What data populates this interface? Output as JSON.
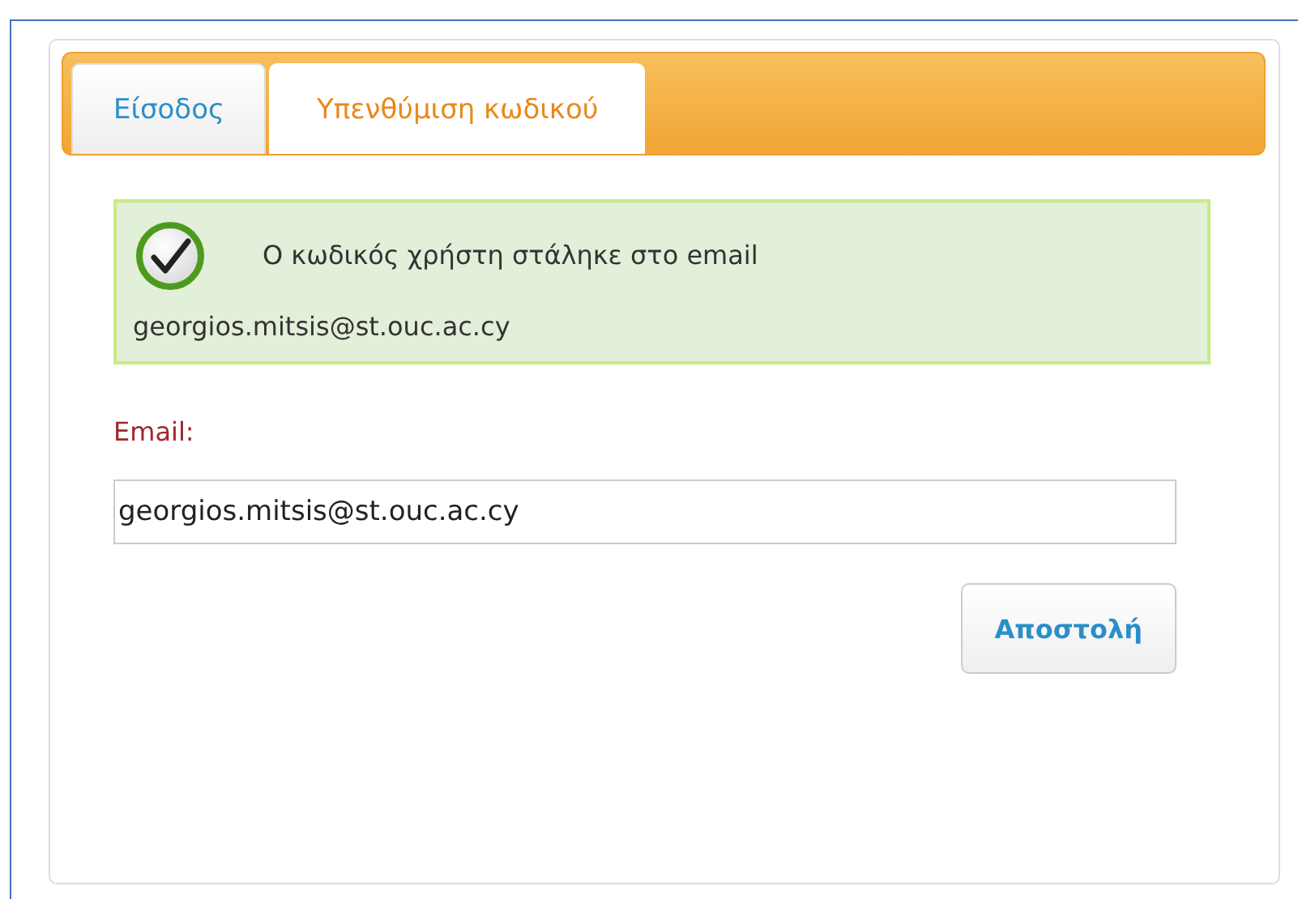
{
  "tabs": [
    {
      "label": "Είσοδος",
      "selected": false
    },
    {
      "label": "Υπενθύμιση κωδικού",
      "selected": true
    }
  ],
  "message": {
    "kind": "success",
    "lines": [
      "Ο κωδικός χρήστη στάληκε στο email",
      "georgios.mitsis@st.ouc.ac.cy"
    ]
  },
  "email_field": {
    "label": "Email:",
    "value": "georgios.mitsis@st.ouc.ac.cy"
  },
  "buttons": [
    "Αποστολή"
  ]
}
